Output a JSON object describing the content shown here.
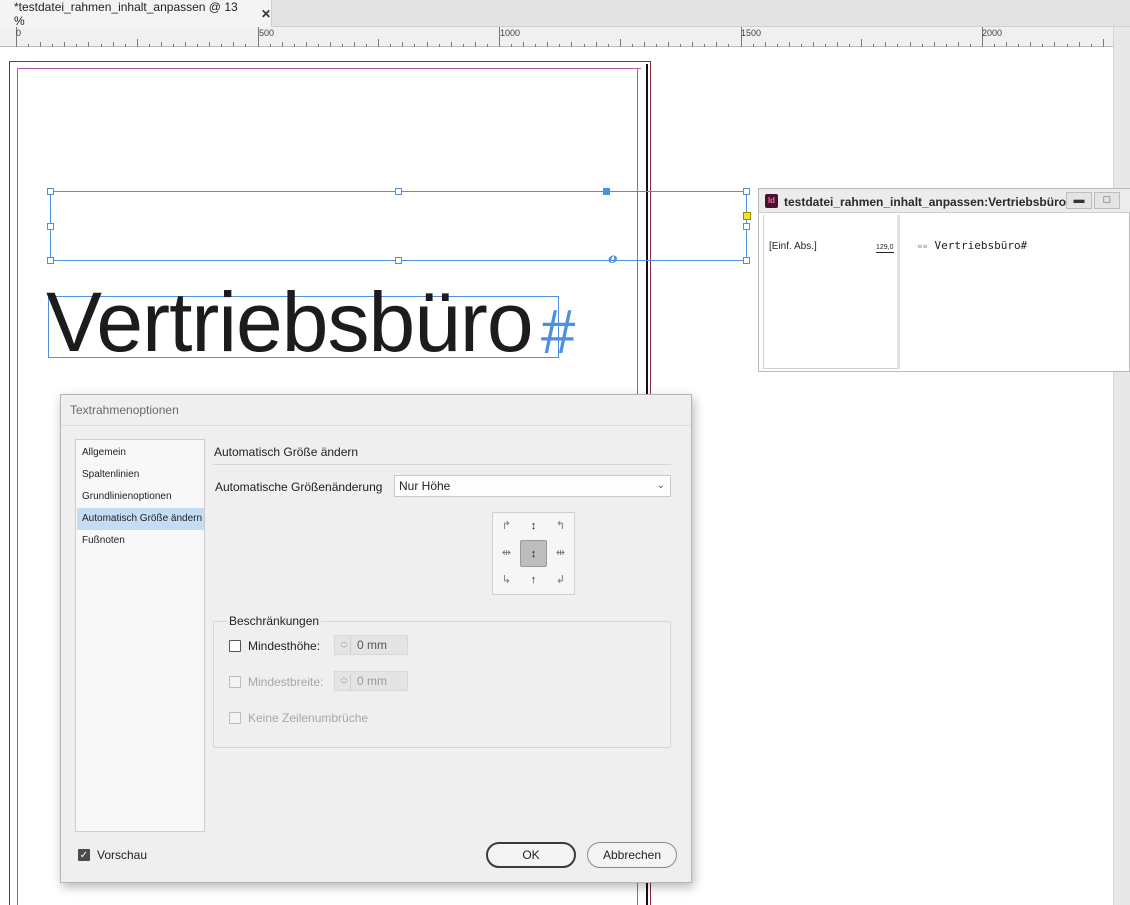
{
  "tab": {
    "title": "*testdatei_rahmen_inhalt_anpassen @ 13 %",
    "close": "✕"
  },
  "ruler": {
    "labels": [
      "0",
      "500",
      "1000",
      "1500",
      "2000"
    ]
  },
  "canvas": {
    "headline": "Vertriebsbüro",
    "hash_mark": "#",
    "anchor_mark": "o"
  },
  "story_editor": {
    "app_icon": "Id",
    "title": "testdatei_rahmen_inhalt_anpassen:Vertriebsbüro",
    "minimize": "▬",
    "maximize": "□",
    "paragraph_style": "[Einf. Abs.]",
    "depth": "129,0",
    "text_marker": "»»",
    "text": "Vertriebsbüro#"
  },
  "dialog": {
    "title": "Textrahmenoptionen",
    "nav": {
      "items": [
        {
          "label": "Allgemein"
        },
        {
          "label": "Spaltenlinien"
        },
        {
          "label": "Grundlinienoptionen"
        },
        {
          "label": "Automatisch Größe ändern"
        },
        {
          "label": "Fußnoten"
        }
      ],
      "active": "Automatisch Größe ändern"
    },
    "section_title": "Automatisch Größe ändern",
    "autoresize": {
      "label": "Automatische Größenänderung",
      "value": "Nur Höhe"
    },
    "reference_point_selected": "center",
    "constraints": {
      "title": "Beschränkungen",
      "min_height": {
        "label": "Mindesthöhe:",
        "value": "0 mm",
        "checked": false,
        "enabled": true
      },
      "min_width": {
        "label": "Mindestbreite:",
        "value": "0 mm",
        "checked": false,
        "enabled": false
      },
      "no_line_breaks": {
        "label": "Keine Zeilenumbrüche",
        "checked": false,
        "enabled": false
      }
    },
    "preview": {
      "label": "Vorschau",
      "checked": true
    },
    "ok_label": "OK",
    "cancel_label": "Abbrechen"
  },
  "colors": {
    "selection": "#4d8fe0",
    "overflow_port": "#f5e32a",
    "nav_active": "#c5dcf5",
    "margin_guide": "#a64d9c"
  },
  "icons": {
    "chevron_down": "chevron-down-icon",
    "check": "check-icon",
    "spin_arrows": "spin-arrows-icon"
  }
}
